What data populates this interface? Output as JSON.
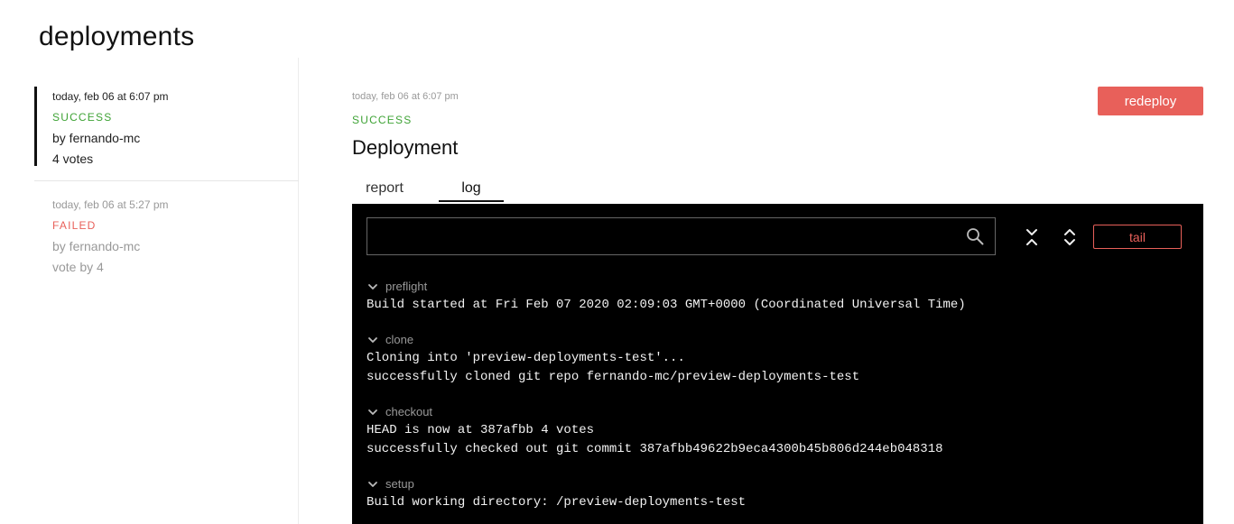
{
  "page": {
    "title": "deployments"
  },
  "sidebar": {
    "items": [
      {
        "time": "today, feb 06 at 6:07 pm",
        "status": "SUCCESS",
        "status_color": "#3fa336",
        "author": "by fernando-mc",
        "votes": "4 votes"
      },
      {
        "time": "today, feb 06 at 5:27 pm",
        "status": "FAILED",
        "status_color": "#e8605a",
        "author": "by fernando-mc",
        "votes": "vote by 4"
      }
    ]
  },
  "main": {
    "time": "today, feb 06 at 6:07 pm",
    "status": "SUCCESS",
    "status_color": "#3fa336",
    "heading": "Deployment",
    "redeploy_label": "redeploy",
    "tabs": [
      {
        "label": "report"
      },
      {
        "label": "log"
      }
    ],
    "console": {
      "search_value": "",
      "tail_label": "tail",
      "sections": [
        {
          "name": "preflight",
          "lines": [
            "Build started at Fri Feb 07 2020 02:09:03 GMT+0000 (Coordinated Universal Time)"
          ]
        },
        {
          "name": "clone",
          "lines": [
            "Cloning into 'preview-deployments-test'...",
            "successfully cloned git repo fernando-mc/preview-deployments-test"
          ]
        },
        {
          "name": "checkout",
          "lines": [
            "HEAD is now at 387afbb 4 votes",
            "successfully checked out git commit 387afbb49622b9eca4300b45b806d244eb048318"
          ]
        },
        {
          "name": "setup",
          "lines": [
            "Build working directory: /preview-deployments-test"
          ]
        }
      ]
    }
  },
  "colors": {
    "accent": "#e8605a",
    "success": "#3fa336",
    "console_bg": "#000000"
  }
}
